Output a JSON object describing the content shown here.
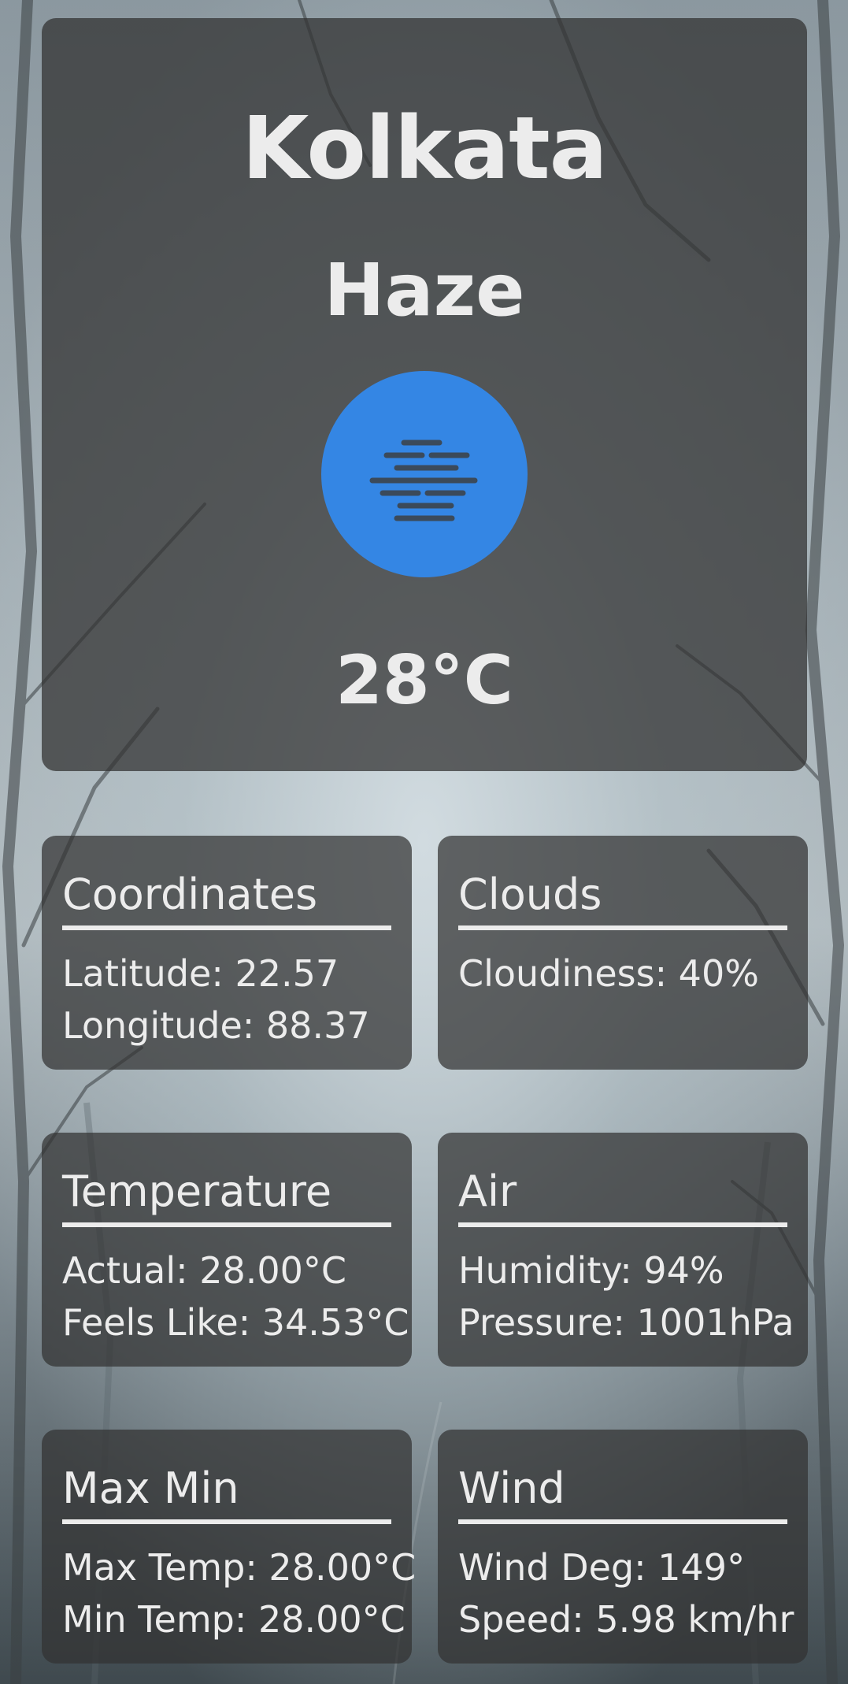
{
  "weather": {
    "city": "Kolkata",
    "condition": "Haze",
    "condition_icon": "haze-icon",
    "temperature": "28°C",
    "icon_color": "#3486e4"
  },
  "cards": {
    "coordinates": {
      "title": "Coordinates",
      "line1": "Latitude: 22.57",
      "line2": "Longitude: 88.37"
    },
    "clouds": {
      "title": "Clouds",
      "line1": "Cloudiness: 40%"
    },
    "temperature": {
      "title": "Temperature",
      "line1": "Actual: 28.00°C",
      "line2": "Feels Like: 34.53°C"
    },
    "air": {
      "title": "Air",
      "line1": "Humidity: 94%",
      "line2": "Pressure: 1001hPa"
    },
    "maxmin": {
      "title": "Max Min",
      "line1": "Max Temp: 28.00°C",
      "line2": "Min Temp: 28.00°C"
    },
    "wind": {
      "title": "Wind",
      "line1": "Wind Deg: 149°",
      "line2": "Speed: 5.98 km/hr"
    }
  }
}
